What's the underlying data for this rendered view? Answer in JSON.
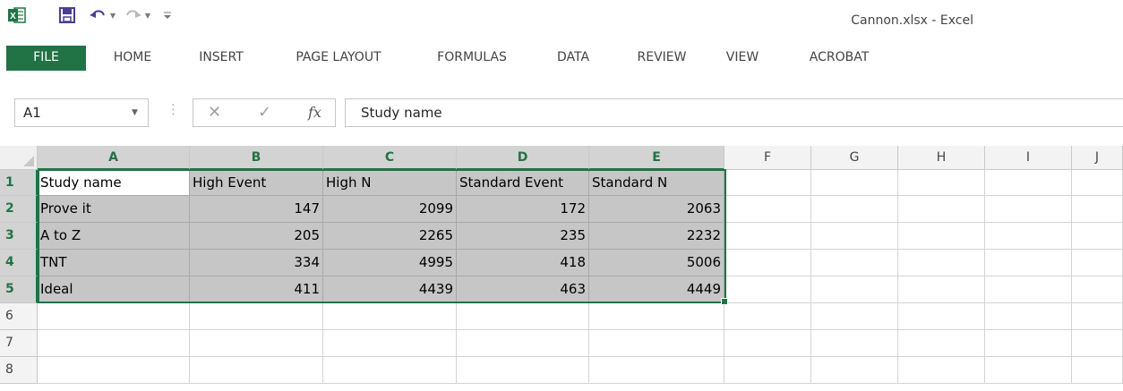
{
  "window": {
    "title": "Cannon.xlsx - Excel"
  },
  "quick_access": {
    "logo_text": "X",
    "icons": [
      "excel-logo-icon",
      "save-icon",
      "undo-icon",
      "redo-icon",
      "customize-icon"
    ]
  },
  "ribbon": {
    "tabs": [
      "FILE",
      "HOME",
      "INSERT",
      "PAGE LAYOUT",
      "FORMULAS",
      "DATA",
      "REVIEW",
      "VIEW",
      "ACROBAT"
    ],
    "active_tab": "FILE",
    "accent_color": "#217346"
  },
  "formula_bar": {
    "name_box": "A1",
    "fx_label": "fx",
    "value": "Study name"
  },
  "sheet": {
    "columns": [
      "A",
      "B",
      "C",
      "D",
      "E",
      "F",
      "G",
      "H",
      "I",
      "J"
    ],
    "rows": [
      "1",
      "2",
      "3",
      "4",
      "5",
      "6",
      "7",
      "8"
    ],
    "cells": [
      [
        "Study name",
        "High Event",
        "High N",
        "Standard Event",
        "Standard N"
      ],
      [
        "Prove it",
        "147",
        "2099",
        "172",
        "2063"
      ],
      [
        "A to Z",
        "205",
        "2265",
        "235",
        "2232"
      ],
      [
        "TNT",
        "334",
        "4995",
        "418",
        "5006"
      ],
      [
        "Ideal",
        "411",
        "4439",
        "463",
        "4449"
      ]
    ],
    "selection": "A1:E5",
    "active_cell": "A1"
  }
}
